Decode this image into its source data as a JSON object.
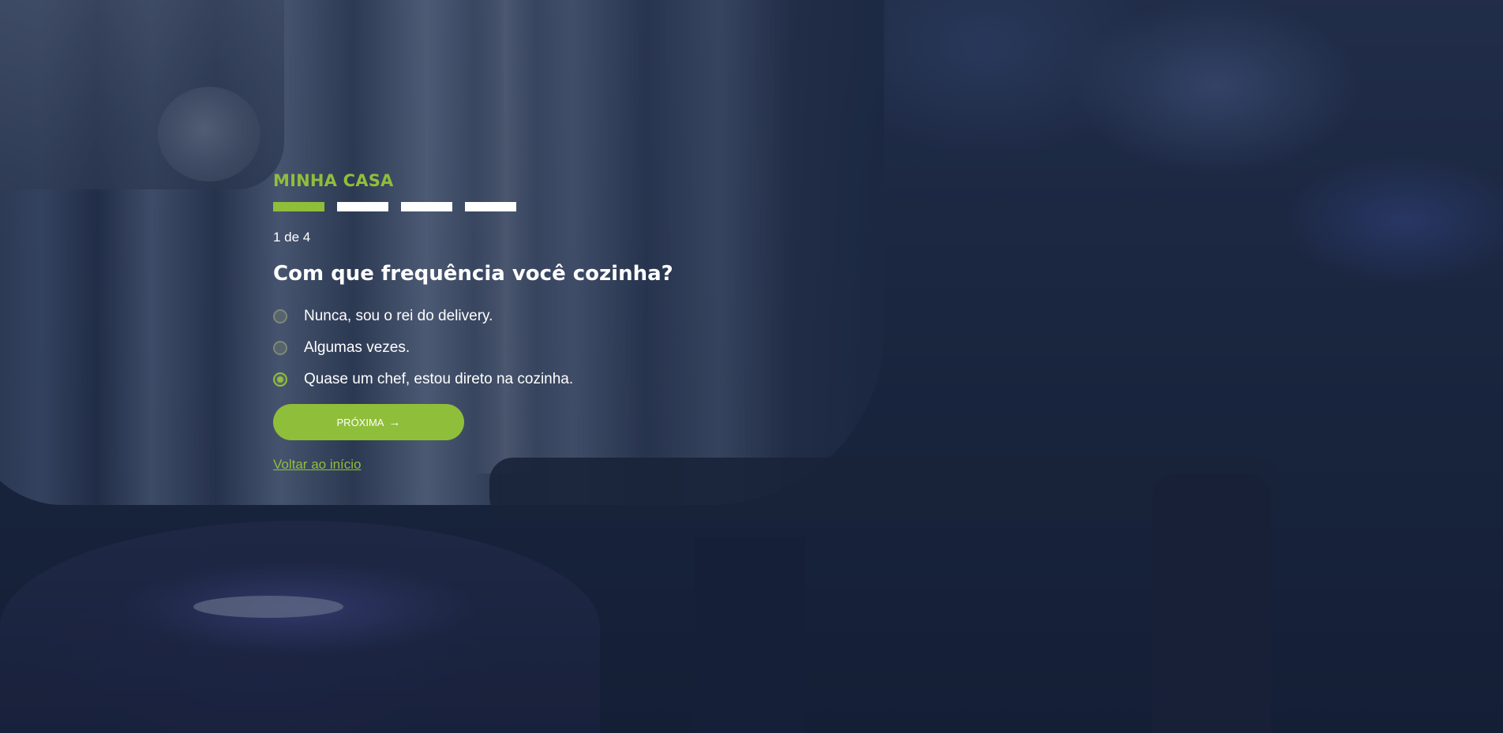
{
  "quiz": {
    "category": "MINHA CASA",
    "steps": {
      "total": 4,
      "current": 1
    },
    "counter": "1 de 4",
    "question": "Com que frequência você cozinha?",
    "options": [
      {
        "label": "Nunca, sou o rei do delivery.",
        "selected": false
      },
      {
        "label": "Algumas vezes.",
        "selected": false
      },
      {
        "label": "Quase um chef, estou direto na cozinha.",
        "selected": true
      }
    ],
    "next_label": "PRÓXIMA",
    "next_icon": "arrow-right-icon",
    "back_label": "Voltar ao início"
  },
  "colors": {
    "accent": "#8fbe3a",
    "text": "#ffffff",
    "step_inactive": "#ffffff"
  }
}
